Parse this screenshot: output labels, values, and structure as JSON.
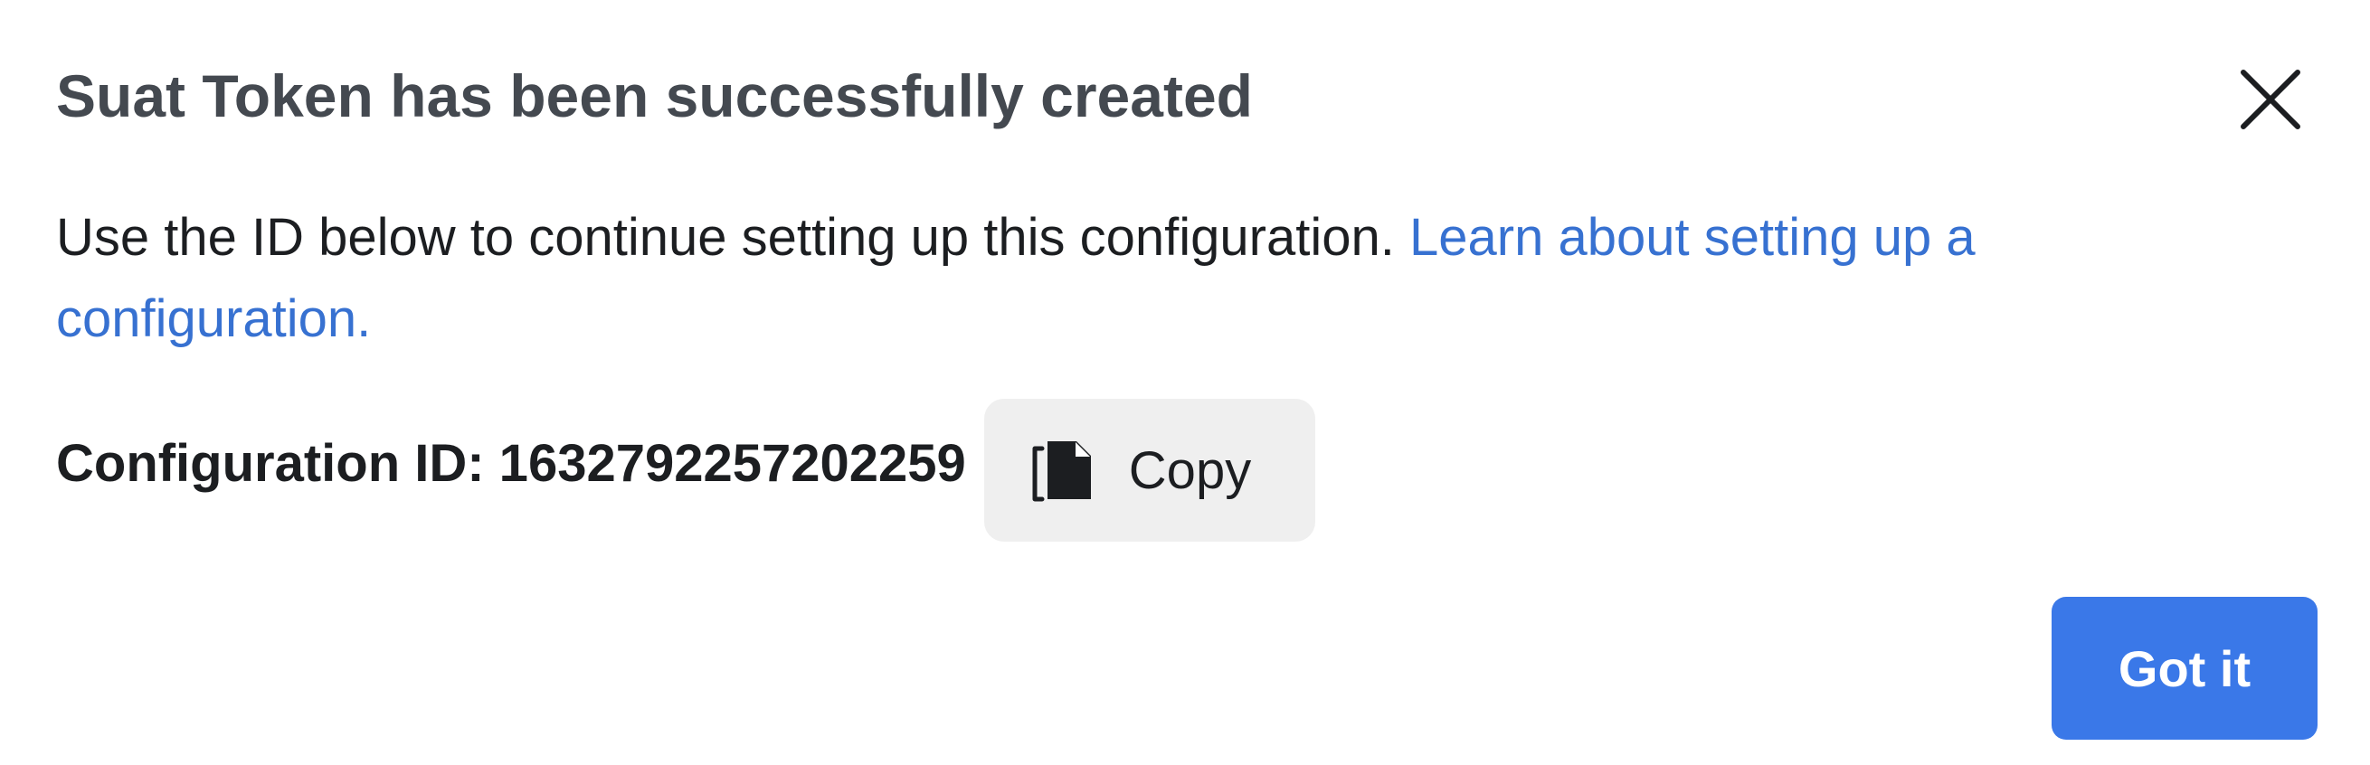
{
  "dialog": {
    "title": "Suat Token has been successfully created",
    "close_icon": "close-icon",
    "body_text": "Use the ID below to continue setting up this configuration. ",
    "learn_link": "Learn about setting up a configuration.",
    "config_label": "Configuration ID: 1632792257202259",
    "copy_icon": "copy-icon",
    "copy_label": "Copy",
    "primary_button": "Got it"
  },
  "colors": {
    "link": "#3771d1",
    "primary": "#3a78e8",
    "copy_bg": "#efefef",
    "title": "#444950"
  }
}
